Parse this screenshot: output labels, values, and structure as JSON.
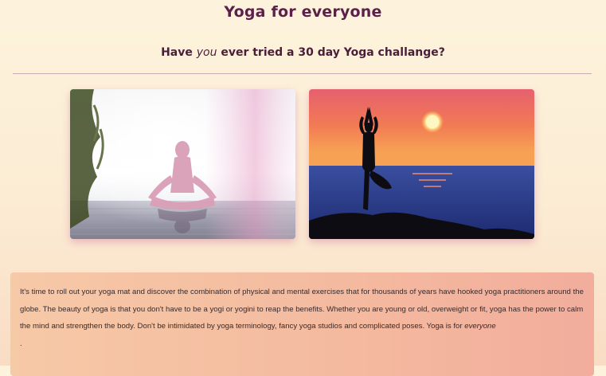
{
  "header": {
    "title": "Yoga for everyone",
    "subtitle_before": "Have ",
    "subtitle_em": "you",
    "subtitle_after": " ever tried a 30 day Yoga challange?"
  },
  "gallery": {
    "images": [
      {
        "name": "woman-meditating-by-water-image",
        "icon": "photo"
      },
      {
        "name": "tree-pose-sunset-image",
        "icon": "photo"
      }
    ]
  },
  "intro": {
    "text": "It's time to roll out your yoga mat and discover the combination of physical and mental exercises that for thousands of years have hooked yoga practitioners around the globe. The beauty of yoga is that you don't have to be a yogi or yogini to reap the benefits. Whether you are young or old, overweight or fit, yoga has the power to calm the mind and strengthen the body. Don't be intimidated by yoga terminology, fancy yoga studios and complicated poses. Yoga is for ",
    "emphasis": "everyone",
    "trailing": "."
  },
  "colors": {
    "title": "#5c1f4a",
    "background_top": "#fdf3dc",
    "text_box": "#f4b99f"
  }
}
